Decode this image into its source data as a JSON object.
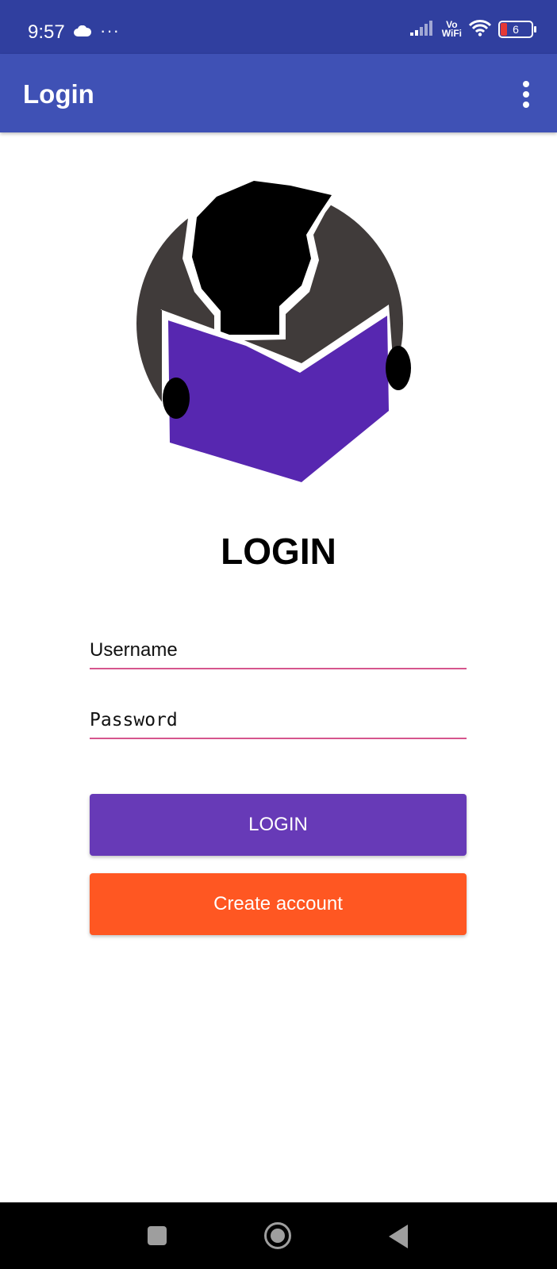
{
  "status_bar": {
    "time": "9:57",
    "more": "···",
    "network_label_top": "Vo",
    "network_label_bottom": "WiFi",
    "battery_level": "6",
    "icons": [
      "cloud-icon",
      "signal-icon",
      "wifi-icon",
      "battery-icon"
    ]
  },
  "app_bar": {
    "title": "Login",
    "menu_icon": "overflow-menu-icon"
  },
  "logo": {
    "icon": "reader-logo-icon",
    "colors": {
      "circle": "#403b3a",
      "book": "#5727b0",
      "figure": "#000000"
    }
  },
  "form": {
    "heading": "LOGIN",
    "username_placeholder": "Username",
    "password_placeholder": "Password",
    "login_button": "LOGIN",
    "create_account_button": "Create account"
  },
  "nav_bar": {
    "icons": [
      "recents-icon",
      "home-icon",
      "back-icon"
    ]
  },
  "colors": {
    "status_bar": "#303f9f",
    "app_bar": "#3f51b5",
    "field_underline": "#d6558d",
    "login_button": "#673ab7",
    "create_button": "#ff5722"
  }
}
